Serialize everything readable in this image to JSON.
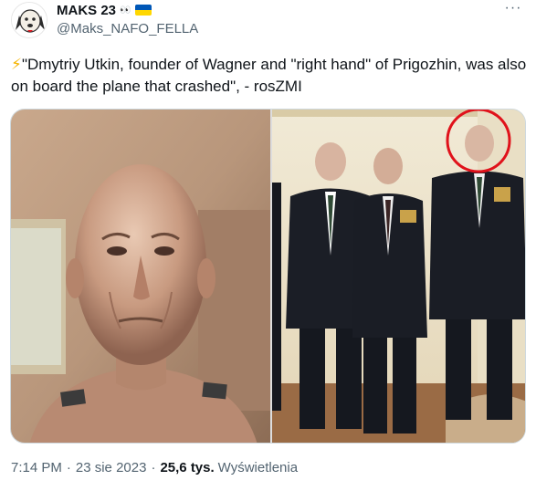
{
  "user": {
    "display_name": "MAKS 23",
    "name_emoji": "👀",
    "handle": "@Maks_NAFO_FELLA",
    "avatar_icon": "nafo-dog-avatar-icon",
    "badge_icon": "ukraine-flag-icon"
  },
  "menu": {
    "more_label": "···"
  },
  "tweet": {
    "bolt": "⚡",
    "text": "\"Dmytriy Utkin, founder of Wagner and \"right hand\" of Prigozhin, was also on board the plane that crashed\", - rosZMI"
  },
  "media": {
    "left_photo": "bald-man-portrait-photo",
    "right_photo": "group-of-men-in-suits-photo",
    "highlight": "red-circle-highlight"
  },
  "meta": {
    "time": "7:14 PM",
    "date": "23 sie 2023",
    "views_count": "25,6 tys.",
    "views_label": "Wyświetlenia",
    "separator": "·"
  },
  "colors": {
    "text_primary": "#0f1419",
    "text_secondary": "#536471",
    "border": "#cfd9de",
    "highlight_red": "#e0121b",
    "flag_blue": "#0057b7",
    "flag_yellow": "#ffd700"
  }
}
